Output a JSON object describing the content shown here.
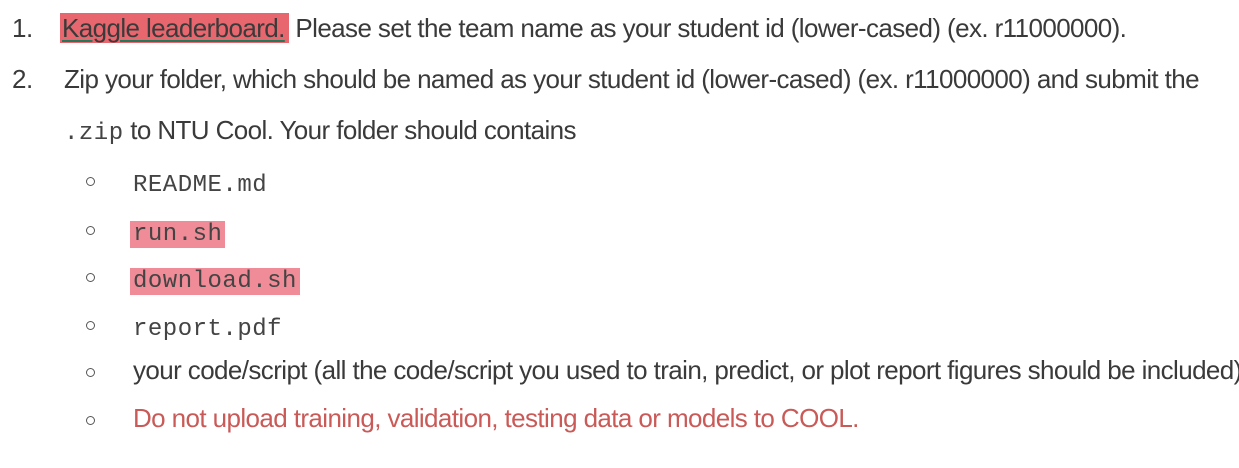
{
  "items": [
    {
      "number": "1.",
      "link_text": "Kaggle leaderboard.",
      "text": " Please set the team name as your student id (lower-cased) (ex. r11000000)."
    },
    {
      "number": "2.",
      "text_line1": "Zip your folder, which should be named as your student id (lower-cased) (ex. r11000000) and submit the",
      "code_zip": ".zip",
      "text_line2": " to NTU Cool. Your folder should contains"
    }
  ],
  "folder_contents": [
    {
      "text": "README.md",
      "style": "code",
      "highlighted": false
    },
    {
      "text": "run.sh",
      "style": "code",
      "highlighted": true
    },
    {
      "text": "download.sh",
      "style": "code",
      "highlighted": true
    },
    {
      "text": "report.pdf",
      "style": "code",
      "highlighted": false
    },
    {
      "text": "your code/script (all the code/script you used to train, predict, or plot report figures should be included).",
      "style": "text",
      "highlighted": false
    },
    {
      "text": "Do not upload training, validation, testing data or models to COOL.",
      "style": "warning",
      "highlighted": false
    }
  ],
  "colors": {
    "text": "#3a3a3a",
    "highlight": "#ef8c97",
    "link_highlight": "#e8676f",
    "warning": "#c95a57"
  }
}
